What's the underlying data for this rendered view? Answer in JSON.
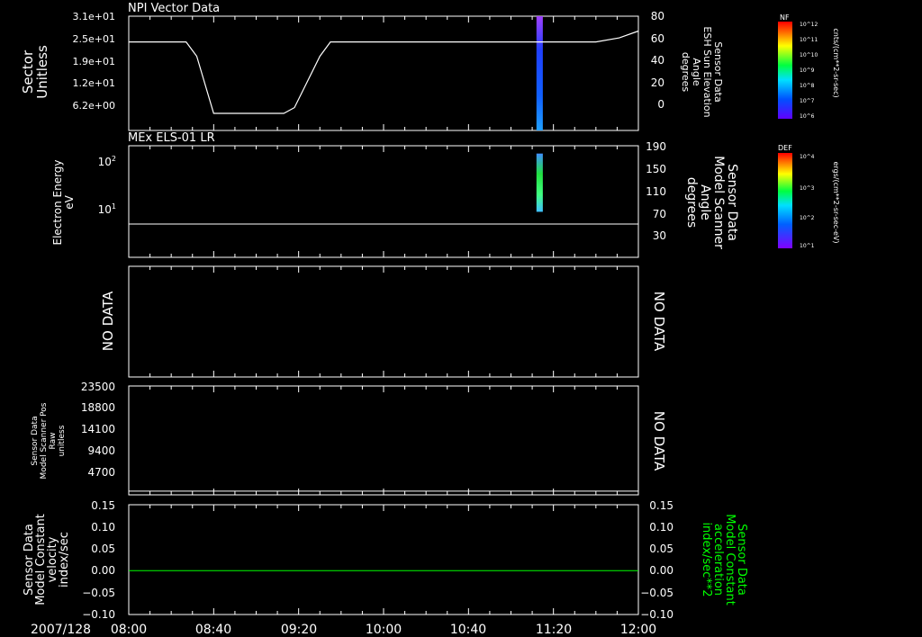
{
  "date_label": "2007/128",
  "time_ticks": [
    "08:00",
    "08:40",
    "09:20",
    "10:00",
    "10:40",
    "11:20",
    "12:00"
  ],
  "colors": {
    "background": "#000000",
    "foreground": "#ffffff",
    "trace_green": "#00ff00"
  },
  "chart_data": [
    {
      "type": "line",
      "title": "NPI Vector Data",
      "ylabel": [
        "Sector",
        "Unitless"
      ],
      "y_tick_labels": [
        "3.1e+01",
        "2.5e+01",
        "1.9e+01",
        "1.2e+01",
        "6.2e+00"
      ],
      "right_ylabel": [
        "Sensor Data",
        "ESH Sun Elevation",
        "Angle",
        "degrees"
      ],
      "right_tick_labels": [
        "80",
        "60",
        "40",
        "20",
        "0"
      ],
      "right_ylim": [
        -20,
        80
      ],
      "series": [
        {
          "x": [
            "08:00",
            "08:27",
            "08:32",
            "08:40",
            "09:13",
            "09:18",
            "09:30",
            "09:35",
            "11:40",
            "11:51",
            "12:00"
          ],
          "values": [
            57.5,
            57.5,
            45,
            -5,
            -5,
            0,
            45,
            57.5,
            57.5,
            61,
            67
          ]
        }
      ],
      "spectrogram_bin": {
        "x_range": [
          "11:12",
          "11:15"
        ],
        "y_range": [
          -20,
          80
        ]
      },
      "colorbar": {
        "label": "NF",
        "unit": "cnts/(cm**2-sr-sec)",
        "ticks": [
          "10^12",
          "10^11",
          "10^10",
          "10^9",
          "10^8",
          "10^7",
          "10^6"
        ]
      }
    },
    {
      "type": "heatmap",
      "title": "MEx ELS-01 LR",
      "ylabel": [
        "Electron Energy",
        "eV"
      ],
      "y_tick_labels": [
        "10^2",
        "10^1"
      ],
      "right_ylabel": [
        "Sensor Data",
        "Model Scanner",
        "Angle",
        "degrees"
      ],
      "right_tick_labels": [
        "190",
        "150",
        "110",
        "70",
        "30"
      ],
      "series": [
        {
          "x": [
            "08:00",
            "12:00"
          ],
          "values": [
            5,
            5
          ]
        }
      ],
      "spectrogram_bin": {
        "x_range": [
          "11:12",
          "11:15"
        ],
        "y_range_eV": [
          9,
          150
        ]
      },
      "colorbar": {
        "label": "DEF",
        "unit": "ergs/(cm**2-sr-sec-eV)",
        "ticks": [
          "10^4",
          "10^3",
          "10^2",
          "10^1"
        ]
      }
    },
    {
      "type": "line",
      "left_text": "NO DATA",
      "right_text": "NO DATA"
    },
    {
      "type": "line",
      "ylabel": [
        "Sensor Data",
        "Model Scanner Pos",
        "Raw",
        "unitless"
      ],
      "y_tick_labels": [
        "23500",
        "18800",
        "14100",
        "9400",
        "4700"
      ],
      "ylim": [
        0,
        23500
      ],
      "right_text": "NO DATA",
      "series": [
        {
          "x": [
            "08:00",
            "12:00"
          ],
          "values": [
            800,
            800
          ]
        }
      ]
    },
    {
      "type": "line",
      "ylabel": [
        "Sensor Data",
        "Model Constant",
        "velocity",
        "index/sec"
      ],
      "y_tick_labels": [
        "0.15",
        "0.10",
        "0.05",
        "0.00",
        "−0.05",
        "−0.10"
      ],
      "ylim": [
        -0.1,
        0.15
      ],
      "right_ylabel": [
        "Sensor Data",
        "Model Constant",
        "acceleration",
        "index/sec**2"
      ],
      "right_tick_labels": [
        "0.15",
        "0.10",
        "0.05",
        "0.00",
        "−0.05",
        "−0.10"
      ],
      "series": [
        {
          "name": "",
          "x": [
            "08:00",
            "12:00"
          ],
          "values": [
            0,
            0
          ]
        }
      ]
    }
  ]
}
